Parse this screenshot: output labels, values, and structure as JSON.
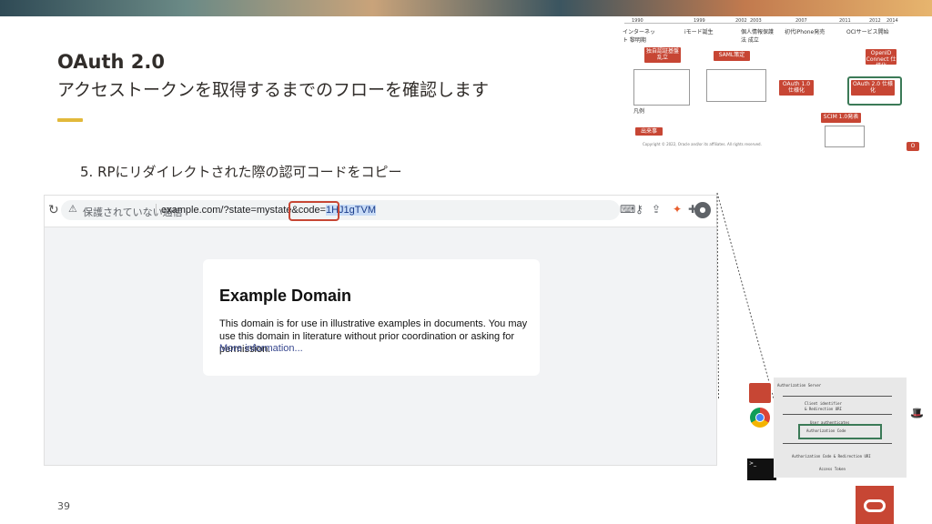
{
  "slide": {
    "title": "OAuth 2.0",
    "subtitle": "アクセストークンを取得するまでのフローを確認します",
    "step": "5. RPにリダイレクトされた際の認可コードをコピー",
    "page_number": "39"
  },
  "browser": {
    "security_label": "保護されていない通信",
    "url_prefix": "example.com/?state=mystate&code=",
    "url_code": "1HJ1gTVM",
    "page": {
      "heading": "Example Domain",
      "body": "This domain is for use in illustrative examples in documents. You may use this domain in literature without prior coordination or asking for permission.",
      "link": "More information..."
    }
  },
  "timeline": {
    "years": [
      "1990",
      "1999",
      "2002",
      "2003",
      "2007",
      "2011",
      "2012",
      "2014"
    ],
    "labels": [
      "インターネット 黎明期",
      "iモード誕生",
      "個人情報保護法 成立",
      "初代iPhone発売",
      "OCIサービス開始"
    ],
    "boxes": [
      "独自認証基盤 乱立",
      "SAML策定",
      "OAuth 1.0 仕様化",
      "OAuth 2.0 仕様化",
      "OpenID Connect 仕様化",
      "SCIM 1.0発表",
      "出来事"
    ],
    "legend": "凡例",
    "footer": "Copyright © 2022, Oracle and/or its affiliates. All rights reserved."
  },
  "flow": {
    "lines": [
      "Authorization Server",
      "Client identifier",
      "& Redirection URI",
      "User authenticates",
      "Authorization Code",
      "Authorization Code & Redirection URI",
      "Access Token"
    ]
  },
  "colors": {
    "accent": "#e2b93b",
    "oracle_red": "#c74634",
    "highlight_green": "#3b7a57"
  }
}
